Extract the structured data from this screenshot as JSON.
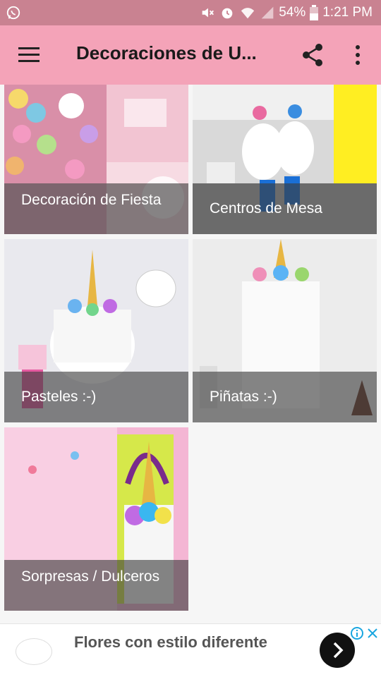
{
  "status_bar": {
    "battery": "54%",
    "time": "1:21 PM",
    "icons": [
      "whatsapp-icon",
      "mute-icon",
      "alarm-icon",
      "wifi-icon",
      "signal-icon",
      "battery-icon"
    ]
  },
  "app_bar": {
    "title": "Decoraciones de U...",
    "icons": [
      "menu-icon",
      "share-icon",
      "more-vert-icon"
    ],
    "background": "#f4a3b8"
  },
  "tiles": [
    {
      "label": "Decoración de Fiesta"
    },
    {
      "label": "Centros de Mesa"
    },
    {
      "label": "Pasteles :-)"
    },
    {
      "label": "Piñatas :-)"
    },
    {
      "label": "Sorpresas / Dulceros"
    }
  ],
  "ad": {
    "text": "Flores con estilo diferente",
    "icons": [
      "ad-info-icon",
      "ad-close-icon",
      "chevron-right-icon"
    ]
  }
}
